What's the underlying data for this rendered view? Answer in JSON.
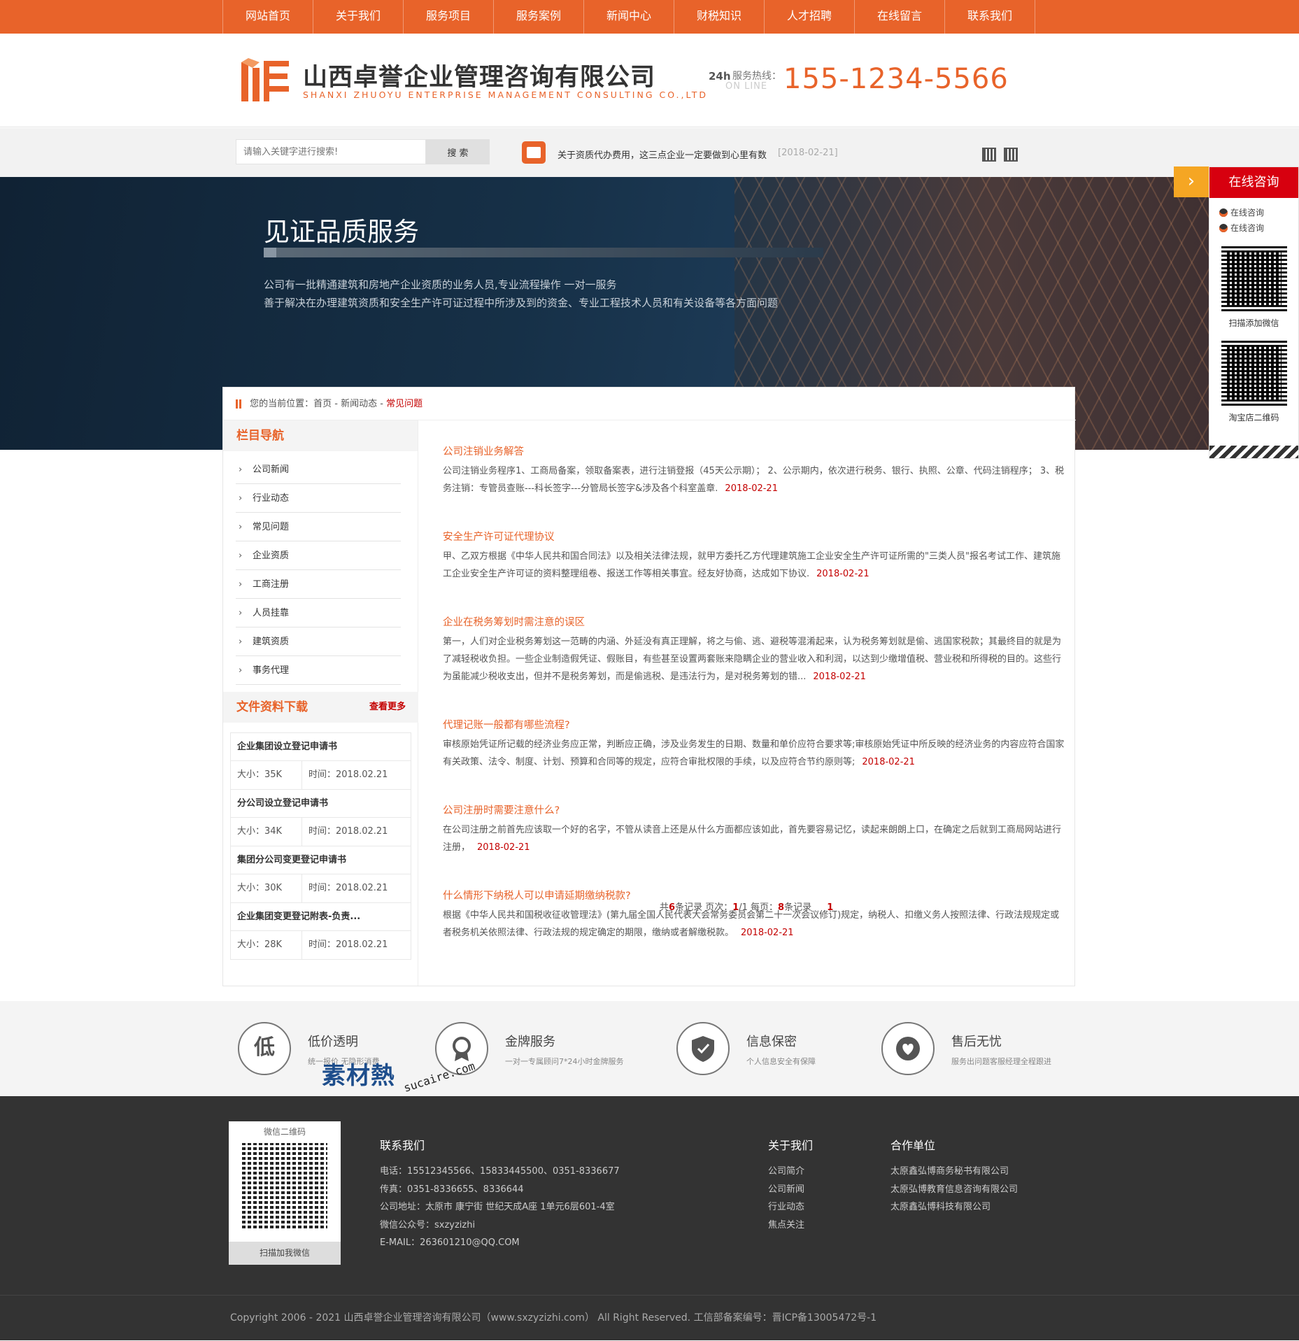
{
  "nav": [
    "网站首页",
    "关于我们",
    "服务项目",
    "服务案例",
    "新闻中心",
    "财税知识",
    "人才招聘",
    "在线留言",
    "联系我们"
  ],
  "header": {
    "company_name": "山西卓誉企业管理咨询有限公司",
    "company_en": "SHANXI ZHUOYU ENTERPRISE MANAGEMENT CONSULTING CO.,LTD",
    "hotline_icon": "24h",
    "hotline_label": "服务热线：",
    "hotline_online": "ON LINE",
    "hotline_number": "155-1234-5566"
  },
  "search": {
    "placeholder": "请输入关键字进行搜索!",
    "button": "搜 索"
  },
  "notice": {
    "text": "关于资质代办费用，这三点企业一定要做到心里有数",
    "date": "[2018-02-21]"
  },
  "banner": {
    "title": "见证品质服务",
    "line1": "公司有一批精通建筑和房地产企业资质的业务人员,专业流程操作   一对一服务",
    "line2": "善于解决在办理建筑资质和安全生产许可证过程中所涉及到的资金、专业工程技术人员和有关设备等各方面问题"
  },
  "breadcrumb": {
    "prefix": "您的当前位置：首页 - 新闻动态 - ",
    "current": "常见问题"
  },
  "sidebar": {
    "heading": "栏目导航",
    "items": [
      "公司新闻",
      "行业动态",
      "常见问题",
      "企业资质",
      "工商注册",
      "人员挂靠",
      "建筑资质",
      "事务代理"
    ]
  },
  "downloads": {
    "heading": "文件资料下载",
    "more": "查看更多",
    "items": [
      {
        "title": "企业集团设立登记申请书",
        "size": "大小：35K",
        "time": "时间：2018.02.21"
      },
      {
        "title": "分公司设立登记申请书",
        "size": "大小：34K",
        "time": "时间：2018.02.21"
      },
      {
        "title": "集团分公司变更登记申请书",
        "size": "大小：30K",
        "time": "时间：2018.02.21"
      },
      {
        "title": "企业集团变更登记附表-负责...",
        "size": "大小：28K",
        "time": "时间：2018.02.21"
      }
    ]
  },
  "articles": [
    {
      "title": "公司注销业务解答",
      "body": "公司注销业务程序1、工商局备案，领取备案表，进行注销登报（45天公示期）； 2、公示期内，依次进行税务、银行、执照、公章、代码注销程序； 3、税务注销：专管员查账---科长签字---分管局长签字&涉及各个科室盖章.",
      "date": "2018-02-21"
    },
    {
      "title": "安全生产许可证代理协议",
      "body": "甲、乙双方根据《中华人民共和国合同法》以及相关法律法规，就甲方委托乙方代理建筑施工企业安全生产许可证所需的\"三类人员\"报名考试工作、建筑施工企业安全生产许可证的资料整理组卷、报送工作等相关事宜。经友好协商，达成如下协议.",
      "date": "2018-02-21"
    },
    {
      "title": "企业在税务筹划时需注意的误区",
      "body": "第一，人们对企业税务筹划这一范畴的内涵、外延没有真正理解，将之与偷、逃、避税等混淆起来，认为税务筹划就是偷、逃国家税款；其最终目的就是为了减轻税收负担。一些企业制造假凭证、假账目，有些甚至设置两套账来隐瞒企业的营业收入和利润，以达到少缴增值税、营业税和所得税的目的。这些行为虽能减少税收支出，但并不是税务筹划，而是偷逃税、是违法行为，是对税务筹划的错...",
      "date": "2018-02-21"
    },
    {
      "title": "代理记账一般都有哪些流程?",
      "body": "审核原始凭证所记载的经济业务应正常，判断应正确，涉及业务发生的日期、数量和单价应符合要求等;审核原始凭证中所反映的经济业务的内容应符合国家有关政策、法令、制度、计划、预算和合同等的规定，应符合审批权限的手续，以及应符合节约原则等;",
      "date": "2018-02-21"
    },
    {
      "title": "公司注册时需要注意什么?",
      "body": "在公司注册之前首先应该取一个好的名字，不管从读音上还是从什么方面都应该如此，首先要容易记忆，读起来朗朗上口，在确定之后就到工商局网站进行注册，",
      "date": "2018-02-21"
    },
    {
      "title": "什么情形下纳税人可以申请延期缴纳税款?",
      "body": "根据《中华人民共和国税收征收管理法》(第九届全国人民代表大会常务委员会第二十一次会议修订)规定，纳税人、扣缴义务人按照法律、行政法规规定或者税务机关依照法律、行政法规的规定确定的期限，缴纳或者解缴税款。",
      "date": "2018-02-21"
    }
  ],
  "pager": {
    "p1": "共",
    "count": "6",
    "p2": "条记录   页次：",
    "page": "1",
    "p3": "/1 每页：",
    "per": "8",
    "p4": "条记录",
    "current": "1"
  },
  "float_panel": {
    "title": "在线咨询",
    "qq1": "在线咨询",
    "qq2": "在线咨询",
    "qr1_caption": "扫描添加微信",
    "qr2_caption": "淘宝店二维码"
  },
  "features": [
    {
      "icon": "低",
      "title": "低价透明",
      "desc": "统一报价 无隐形消费"
    },
    {
      "icon": "",
      "title": "金牌服务",
      "desc": "一对一专属顾问7*24小时金牌服务"
    },
    {
      "icon": "",
      "title": "信息保密",
      "desc": "个人信息安全有保障"
    },
    {
      "icon": "",
      "title": "售后无忧",
      "desc": "服务出问题客服经理全程跟进"
    }
  ],
  "watermark": {
    "text": "素材熱",
    "url": "sucaire.com"
  },
  "footer": {
    "qr_top": "微信二维码",
    "qr_caption": "扫描加我微信",
    "contact_title": "联系我们",
    "contact": [
      "电话：15512345566、15833445500、0351-8336677",
      "传真：0351-8336655、8336644",
      "公司地址：太原市 康宁街 世纪天成A座 1单元6层601-4室",
      "微信公众号：sxzyzizhi",
      "E-MAIL：263601210@QQ.COM"
    ],
    "about_title": "关于我们",
    "about": [
      "公司简介",
      "公司新闻",
      "行业动态",
      "焦点关注"
    ],
    "partner_title": "合作单位",
    "partners": [
      "太原鑫弘博商务秘书有限公司",
      "太原弘博教育信息咨询有限公司",
      "太原鑫弘博科技有限公司"
    ]
  },
  "copyright": "Copyright 2006 - 2021  山西卓誉企业管理咨询有限公司（www.sxzyzizhi.com）  All Right Reserved.   工信部备案编号：晋ICP备13005472号-1",
  "colors": {
    "accent": "#e8632a",
    "red": "#c40000",
    "consult_red": "#d7000f",
    "footer_bg": "#333333"
  }
}
